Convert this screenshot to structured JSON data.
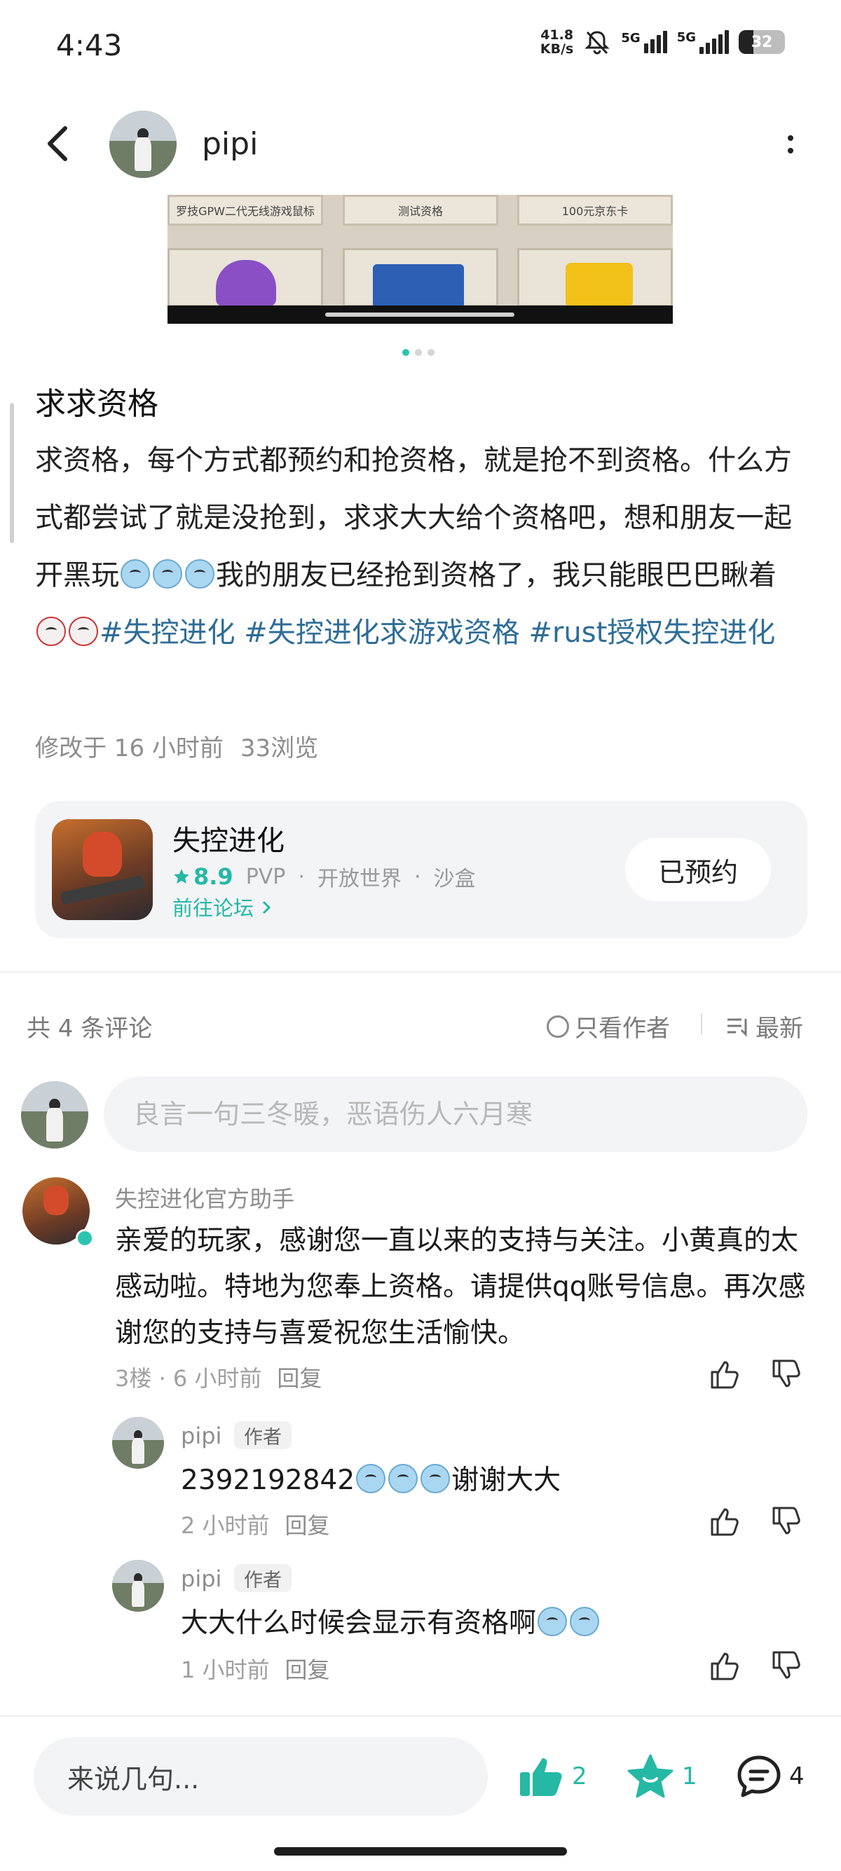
{
  "status_bar": {
    "time": "4:43",
    "net_speed": "41.8",
    "net_unit": "KB/s",
    "sim1": "5G",
    "sim2": "5G",
    "battery": "32",
    "battery_level": 0.32
  },
  "header": {
    "username": "pipi"
  },
  "banner": {
    "cards": [
      "罗技GPW二代无线游戏鼠标",
      "测试资格",
      "100元京东卡"
    ],
    "page_count": 3,
    "active_page": 0
  },
  "post": {
    "title": "求求资格",
    "text1": "求资格，每个方式都预约和抢资格，就是抢不到资格。什么方式都尝试了就是没抢到，求求大大给个资格吧，想和朋友一起开黑玩",
    "text2": "我的朋友已经抢到资格了，我只能眼巴巴瞅着",
    "tags": [
      "#失控进化",
      "#失控进化求游戏资格",
      "#rust授权失控进化"
    ],
    "edited": "修改于 16 小时前",
    "views": "33浏览"
  },
  "game": {
    "name": "失控进化",
    "score": "8.9",
    "genres": [
      "PVP",
      "开放世界",
      "沙盒"
    ],
    "forum_link": "前往论坛",
    "reserved_label": "已预约"
  },
  "comments_header": {
    "count": "共 4 条评论",
    "author_only": "只看作者",
    "sort": "最新"
  },
  "comment_input": {
    "placeholder": "良言一句三冬暖，恶语伤人六月寒"
  },
  "comments": [
    {
      "name": "失控进化官方助手",
      "text": "亲爱的玩家，感谢您一直以来的支持与关注。小黄真的太感动啦。特地为您奉上资格。请提供qq账号信息。再次感谢您的支持与喜爱祝您生活愉快。",
      "floor": "3楼 · 6 小时前",
      "reply": "回复"
    },
    {
      "name": "pipi",
      "badge": "作者",
      "text": "2392192842",
      "text_suffix": "谢谢大大",
      "time": "2 小时前",
      "reply": "回复"
    },
    {
      "name": "pipi",
      "badge": "作者",
      "text": "大大什么时候会显示有资格啊",
      "time": "1 小时前",
      "reply": "回复"
    }
  ],
  "bottom_bar": {
    "input_placeholder": "来说几句...",
    "likes": "2",
    "stars": "1",
    "comments": "4"
  },
  "colors": {
    "accent": "#25b8a5",
    "tag": "#2e6d97",
    "muted": "#8d8d8d"
  }
}
